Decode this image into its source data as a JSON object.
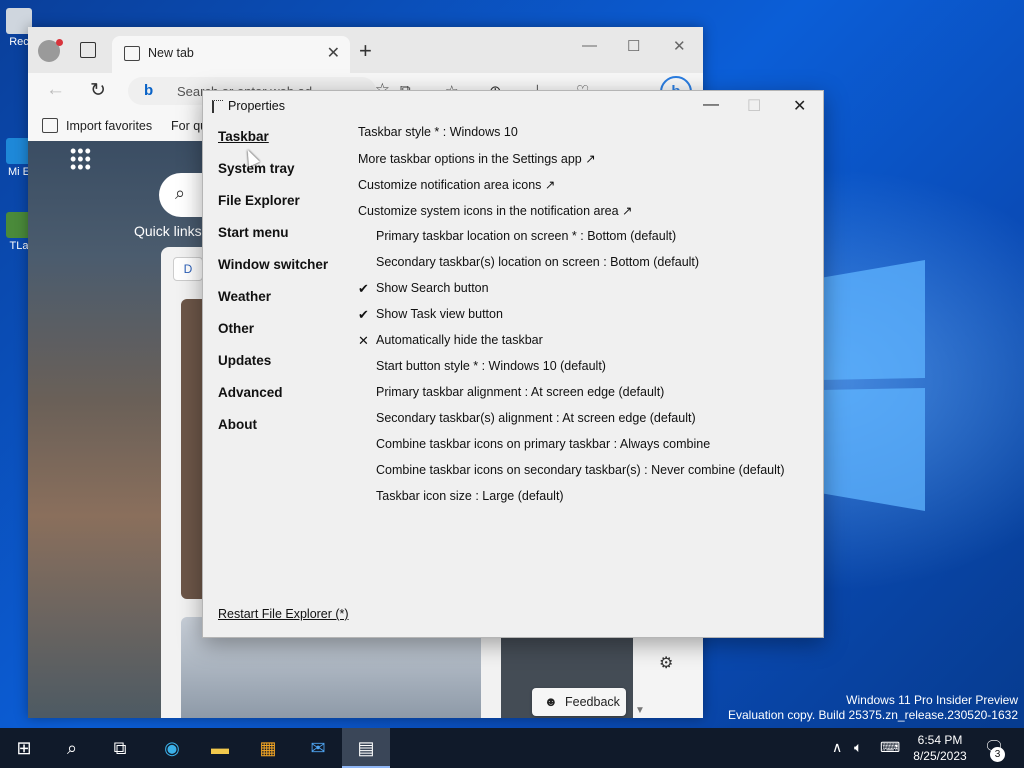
{
  "desktop": {
    "icons": [
      {
        "label": "Rec"
      },
      {
        "label": "Mi E"
      },
      {
        "label": "TLa"
      }
    ],
    "watermark": {
      "line1": "Windows 11 Pro Insider Preview",
      "line2": "Evaluation copy. Build 25375.zn_release.230520-1632"
    }
  },
  "browser": {
    "tab": {
      "title": "New tab",
      "close": "✕"
    },
    "new_tab": "+",
    "window_controls": {
      "minimize": "—",
      "maximize": "☐",
      "close": "✕"
    },
    "address": {
      "bing": "b",
      "placeholder": "Search or enter web ad..."
    },
    "favorites": [
      {
        "label": "Import favorites"
      },
      {
        "label": "For qu"
      }
    ],
    "page": {
      "quick_links": "Quick links",
      "feed_chip": "D",
      "feedback": "Feedback"
    }
  },
  "dialog": {
    "title": "Properties",
    "controls": {
      "minimize": "—",
      "maximize": "☐",
      "close": "✕"
    },
    "nav": [
      {
        "label": "Taskbar",
        "active": true
      },
      {
        "label": "System tray"
      },
      {
        "label": "File Explorer"
      },
      {
        "label": "Start menu"
      },
      {
        "label": "Window switcher"
      },
      {
        "label": "Weather"
      },
      {
        "label": "Other"
      },
      {
        "label": "Updates"
      },
      {
        "label": "Advanced"
      },
      {
        "label": "About"
      }
    ],
    "settings": [
      {
        "text": "Taskbar style * : Windows 10",
        "level": 0,
        "mark": ""
      },
      {
        "text": "More taskbar options in the Settings app ↗",
        "level": 0,
        "mark": ""
      },
      {
        "text": "Customize notification area icons ↗",
        "level": 0,
        "mark": ""
      },
      {
        "text": "Customize system icons in the notification area ↗",
        "level": 0,
        "mark": ""
      },
      {
        "text": "Primary taskbar location on screen * : Bottom (default)",
        "level": 1,
        "mark": ""
      },
      {
        "text": "Secondary taskbar(s) location on screen : Bottom (default)",
        "level": 1,
        "mark": ""
      },
      {
        "text": "Show Search button",
        "level": 1,
        "mark": "✔"
      },
      {
        "text": "Show Task view button",
        "level": 1,
        "mark": "✔"
      },
      {
        "text": "Automatically hide the taskbar",
        "level": 1,
        "mark": "✕"
      },
      {
        "text": "Start button style * : Windows 10 (default)",
        "level": 1,
        "mark": ""
      },
      {
        "text": "Primary taskbar alignment : At screen edge (default)",
        "level": 1,
        "mark": ""
      },
      {
        "text": "Secondary taskbar(s) alignment : At screen edge (default)",
        "level": 1,
        "mark": ""
      },
      {
        "text": "Combine taskbar icons on primary taskbar : Always combine",
        "level": 1,
        "mark": ""
      },
      {
        "text": "Combine taskbar icons on secondary taskbar(s) : Never combine (default)",
        "level": 1,
        "mark": ""
      },
      {
        "text": "Taskbar icon size : Large (default)",
        "level": 1,
        "mark": ""
      }
    ],
    "restart_link": "Restart File Explorer (*)"
  },
  "taskbar": {
    "clock": {
      "time": "6:54 PM",
      "date": "8/25/2023"
    },
    "notification_count": "3",
    "icons": [
      "windows-start-icon",
      "search-icon",
      "task-view-icon",
      "edge-icon",
      "file-explorer-icon",
      "store-icon",
      "mail-icon",
      "properties-app-icon"
    ]
  }
}
